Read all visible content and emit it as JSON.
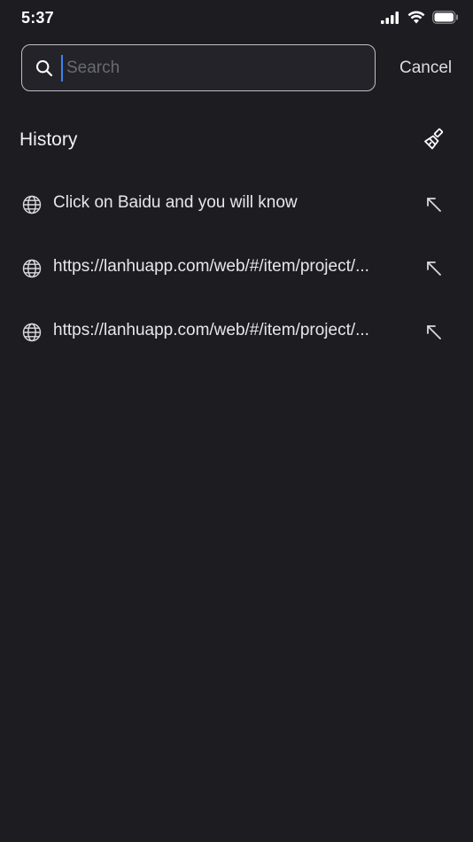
{
  "status_bar": {
    "time": "5:37",
    "icons": [
      "cellular-signal-icon",
      "wifi-icon",
      "battery-icon"
    ]
  },
  "search": {
    "placeholder": "Search",
    "value": "",
    "cancel_label": "Cancel"
  },
  "history": {
    "title": "History",
    "clear_icon": "broom-icon",
    "items": [
      {
        "text": "Click on Baidu and you will know",
        "icon": "globe-icon",
        "action_icon": "arrow-up-left-icon"
      },
      {
        "text": "https://lanhuapp.com/web/#/item/project/...",
        "icon": "globe-icon",
        "action_icon": "arrow-up-left-icon"
      },
      {
        "text": "https://lanhuapp.com/web/#/item/project/...",
        "icon": "globe-icon",
        "action_icon": "arrow-up-left-icon"
      }
    ]
  },
  "colors": {
    "background": "#1c1c21",
    "text": "#e9e9ee",
    "caret": "#3b82f6",
    "search_border": "#bfc0c6"
  }
}
